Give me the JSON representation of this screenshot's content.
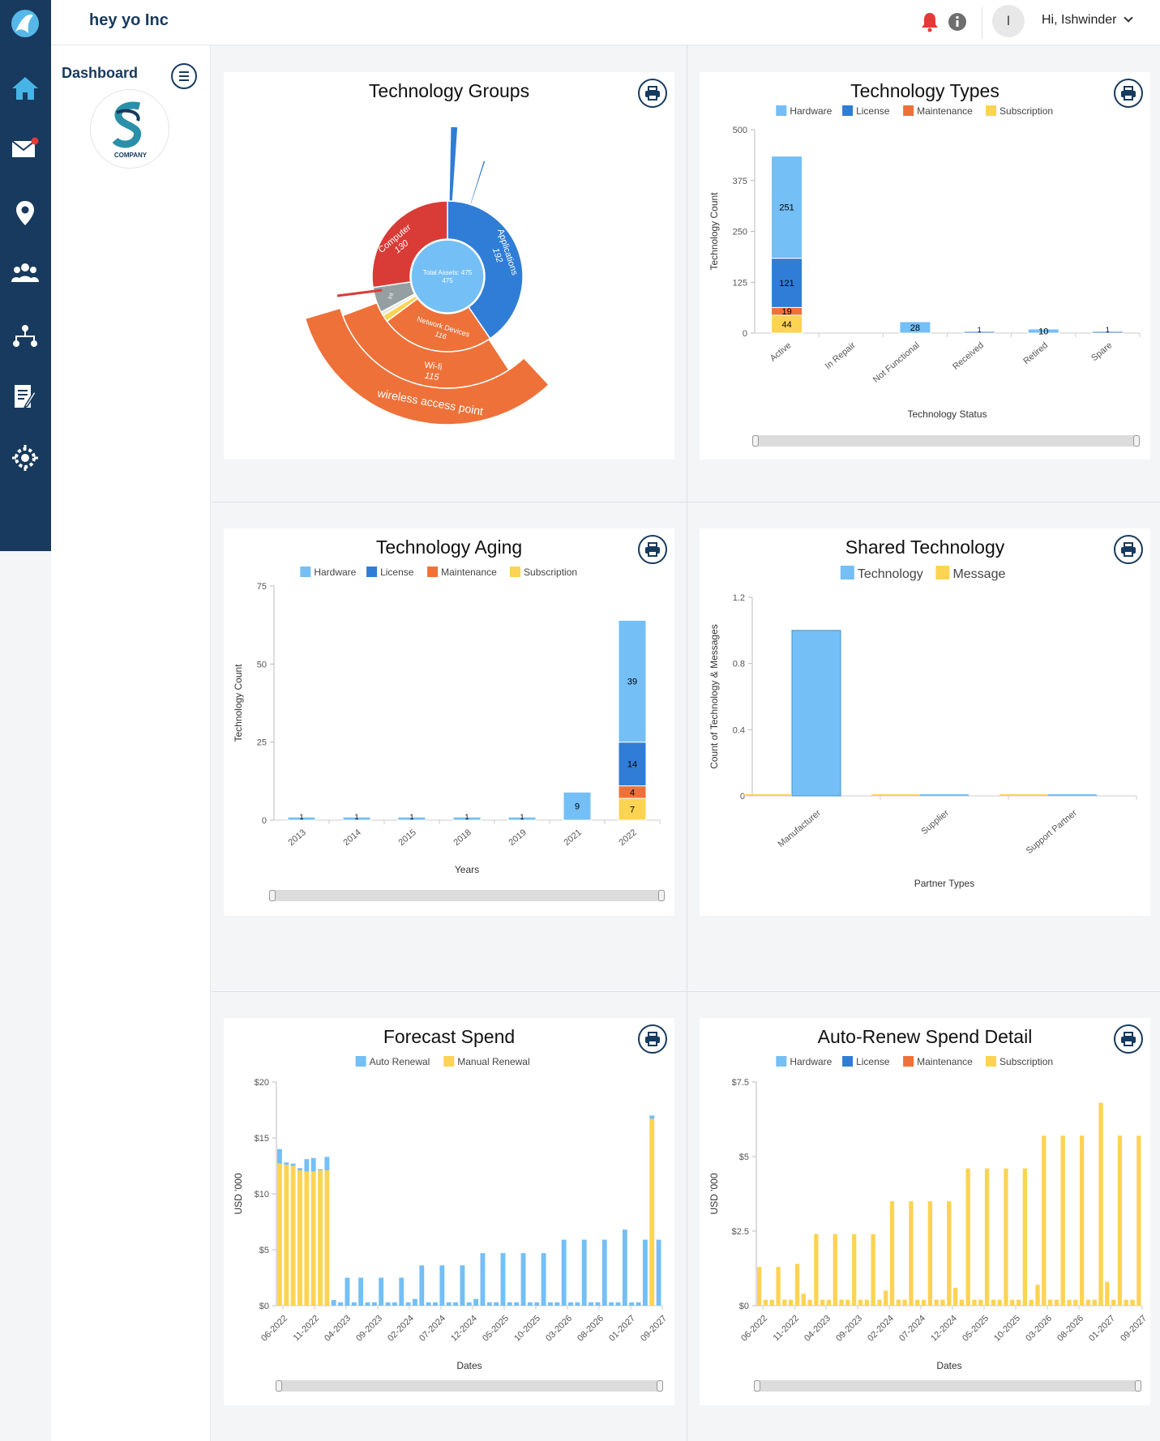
{
  "header": {
    "company_name": "hey yo Inc",
    "greeting": "Hi, Ishwinder",
    "avatar_initial": "I"
  },
  "sidebar": {
    "title": "Dashboard",
    "logo_text": "COMPANY"
  },
  "rail": {
    "items": [
      "home-icon",
      "mail-icon",
      "location-icon",
      "users-icon",
      "org-chart-icon",
      "document-edit-icon",
      "settings-icon"
    ]
  },
  "colors": {
    "hardware": "#74bff5",
    "license": "#2f7dd6",
    "maintenance": "#ee7139",
    "subscription": "#fdd352",
    "auto": "#74bff5",
    "manual": "#fdd352",
    "technology": "#74bff5",
    "message": "#fdd352",
    "navy": "#173a5e",
    "red": "#d93b37",
    "grey": "#959ea1"
  },
  "cards": {
    "groups": {
      "title": "Technology Groups"
    },
    "types": {
      "title": "Technology Types"
    },
    "aging": {
      "title": "Technology Aging"
    },
    "shared": {
      "title": "Shared Technology"
    },
    "forecast": {
      "title": "Forecast Spend"
    },
    "autorenew": {
      "title": "Auto-Renew Spend Detail"
    }
  },
  "chart_data": [
    {
      "id": "groups",
      "type": "sunburst",
      "title": "Technology Groups",
      "center": {
        "label": "Total Assets: 475",
        "value": "475"
      },
      "slices": [
        {
          "name": "Applications",
          "value": 192,
          "label": "Applications\n192"
        },
        {
          "name": "Network Devices",
          "value": 116,
          "label": "Network Devices\n116"
        },
        {
          "name": "Small group",
          "value": 7
        },
        {
          "name": "Small group",
          "value": 4
        },
        {
          "name": "Other",
          "value": 26,
          "label": "Int"
        },
        {
          "name": "Computer",
          "value": 130,
          "label": "Computer\n130"
        }
      ],
      "children": [
        {
          "name": "Wi-fi",
          "value": 115,
          "label": "Wi-fi\n115"
        },
        {
          "name": "wireless access point",
          "value": 115,
          "label": "wireless access point"
        }
      ]
    },
    {
      "id": "types",
      "type": "bar",
      "title": "Technology Types",
      "xlabel": "Technology Status",
      "ylabel": "Technology Count",
      "ylim": [
        0,
        500
      ],
      "yticks": [
        "0",
        "125",
        "250",
        "375",
        "500"
      ],
      "categories": [
        "Active",
        "In Repair",
        "Not Functional",
        "Received",
        "Retired",
        "Spare"
      ],
      "series": [
        {
          "name": "Subscription",
          "values": [
            44,
            0,
            0,
            0,
            0,
            0
          ]
        },
        {
          "name": "Maintenance",
          "values": [
            19,
            0,
            0,
            0,
            0,
            0
          ]
        },
        {
          "name": "License",
          "values": [
            121,
            0,
            0,
            1,
            0,
            1
          ]
        },
        {
          "name": "Hardware",
          "values": [
            251,
            0,
            28,
            0,
            10,
            0
          ]
        }
      ],
      "data_labels": [
        "251",
        "121",
        "19",
        "44",
        "28"
      ]
    },
    {
      "id": "aging",
      "type": "bar",
      "title": "Technology Aging",
      "xlabel": "Years",
      "ylabel": "Technology Count",
      "ylim": [
        0,
        75
      ],
      "yticks": [
        "0",
        "25",
        "50",
        "75"
      ],
      "categories": [
        "2013",
        "2014",
        "2015",
        "2018",
        "2019",
        "2021",
        "2022"
      ],
      "series": [
        {
          "name": "Subscription",
          "values": [
            0,
            0,
            0,
            0,
            0,
            0,
            7
          ]
        },
        {
          "name": "Maintenance",
          "values": [
            0,
            0,
            0,
            0,
            0,
            0,
            4
          ]
        },
        {
          "name": "License",
          "values": [
            0,
            0,
            0,
            0,
            0,
            0,
            14
          ]
        },
        {
          "name": "Hardware",
          "values": [
            1,
            1,
            1,
            1,
            1,
            9,
            39
          ]
        }
      ],
      "data_labels": [
        "39",
        "14",
        "4",
        "7",
        "9"
      ]
    },
    {
      "id": "shared",
      "type": "bar",
      "title": "Shared Technology",
      "xlabel": "Partner Types",
      "ylabel": "Count of Technology & Messages",
      "ylim": [
        0,
        1.2
      ],
      "yticks": [
        "0",
        "0.4",
        "0.8",
        "1.2"
      ],
      "categories": [
        "Manufacturer",
        "Supplier",
        "Support Partner"
      ],
      "series": [
        {
          "name": "Technology",
          "values": [
            1,
            0,
            0
          ]
        },
        {
          "name": "Message",
          "values": [
            0,
            0,
            0
          ]
        }
      ]
    },
    {
      "id": "forecast",
      "type": "bar",
      "title": "Forecast Spend",
      "xlabel": "Dates",
      "ylabel": "USD '000",
      "ylim": [
        0,
        20
      ],
      "yticks": [
        "$0",
        "$5",
        "$10",
        "$15",
        "$20"
      ],
      "xticks": [
        "06-2022",
        "11-2022",
        "04-2023",
        "09-2023",
        "02-2024",
        "07-2024",
        "12-2024",
        "05-2025",
        "10-2025",
        "03-2026",
        "08-2026",
        "01-2027",
        "09-2027"
      ],
      "series": [
        {
          "name": "Auto Renewal",
          "values": [
            1.3,
            0.2,
            0.2,
            0.2,
            1.1,
            1.2,
            0.1,
            1.2,
            0.5,
            0.3,
            2.5,
            0.3,
            2.5,
            0.3,
            0.3,
            2.5,
            0.3,
            0.3,
            2.5,
            0.3,
            0.6,
            3.6,
            0.3,
            0.3,
            3.6,
            0.3,
            0.3,
            3.6,
            0.3,
            0.6,
            4.7,
            0.3,
            0.3,
            4.7,
            0.3,
            0.3,
            4.7,
            0.3,
            0.3,
            4.7,
            0.3,
            0.3,
            5.9,
            0.3,
            0.3,
            5.9,
            0.3,
            0.3,
            5.9,
            0.3,
            0.3,
            6.8,
            0.3,
            0.3,
            5.9,
            0.3,
            5.9
          ]
        },
        {
          "name": "Manual Renewal",
          "values": [
            12.7,
            12.6,
            12.5,
            12.1,
            12.0,
            12.0,
            12.1,
            12.1,
            0,
            0,
            0,
            0,
            0,
            0,
            0,
            0,
            0,
            0,
            0,
            0,
            0,
            0,
            0,
            0,
            0,
            0,
            0,
            0,
            0,
            0,
            0,
            0,
            0,
            0,
            0,
            0,
            0,
            0,
            0,
            0,
            0,
            0,
            0,
            0,
            0,
            0,
            0,
            0,
            0,
            0,
            0,
            0,
            0,
            0,
            0,
            16.7,
            0
          ]
        }
      ]
    },
    {
      "id": "autorenew",
      "type": "bar",
      "title": "Auto-Renew Spend Detail",
      "xlabel": "Dates",
      "ylabel": "USD '000",
      "ylim": [
        0,
        7.5
      ],
      "yticks": [
        "$0",
        "$2.5",
        "$5",
        "$7.5"
      ],
      "xticks": [
        "06-2022",
        "11-2022",
        "04-2023",
        "09-2023",
        "02-2024",
        "07-2024",
        "12-2024",
        "05-2025",
        "10-2025",
        "03-2026",
        "08-2026",
        "01-2027",
        "09-2027"
      ],
      "series": [
        {
          "name": "Subscription",
          "values": [
            1.3,
            0.2,
            0.2,
            1.3,
            0.2,
            0.2,
            1.4,
            0.4,
            0.2,
            2.4,
            0.2,
            0.2,
            2.4,
            0.2,
            0.2,
            2.4,
            0.2,
            0.2,
            2.4,
            0.2,
            0.5,
            3.5,
            0.2,
            0.2,
            3.5,
            0.2,
            0.2,
            3.5,
            0.2,
            0.2,
            3.5,
            0.6,
            0.2,
            4.6,
            0.2,
            0.2,
            4.6,
            0.2,
            0.2,
            4.6,
            0.2,
            0.2,
            4.6,
            0.2,
            0.7,
            5.7,
            0.2,
            0.2,
            5.7,
            0.2,
            0.2,
            5.7,
            0.2,
            0.2,
            6.8,
            0.8,
            0.2,
            5.7,
            0.2,
            0.2,
            5.7
          ]
        }
      ]
    }
  ]
}
